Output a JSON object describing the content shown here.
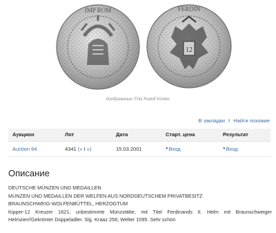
{
  "image": {
    "caption": "Изображение: Fritz Rudolf Künker",
    "obverse_legend": "IMP ROM",
    "reverse_legend": "FERDIN"
  },
  "actions": {
    "bookmarks": "В закладки",
    "separator": "I",
    "find_similar": "Найти похожие"
  },
  "table": {
    "headers": [
      "Аукцион",
      "Лот",
      "Дата",
      "Старт. цена",
      "Результат"
    ],
    "row": {
      "auction": "Auction 64",
      "lot": "4341",
      "lot_nav_prev": "«",
      "lot_nav_sep": "I",
      "lot_nav_next": "»",
      "date": "15.03.2001",
      "start_price": "Вход",
      "result": "Вход"
    }
  },
  "description": {
    "title": "Описание",
    "lines": [
      "DEUTSCHE MÜNZEN UND MEDAILLEN",
      "MÜNZEN UND MEDAILLEN DER WELFEN AUS NORDDEUTSCHEM PRIVATBESITZ",
      "BRAUNSCHWEIG-WOLFENBÜTTEL, HERZOGTUM",
      "Kipper-12 Kreuzer 1621, unbestimmte Münzstätte, mit Titel Ferdinands II. Helm mit Braunschweiger Helmzier//Gekrönter Doppeladler. Slg. Kraaz 256; Welter 1095. Sehr schön"
    ]
  },
  "colors": {
    "link": "#3a6ea8",
    "header_bg": "#f2f2f2",
    "coin_light": "#dcdcdc",
    "coin_dark": "#444444"
  }
}
